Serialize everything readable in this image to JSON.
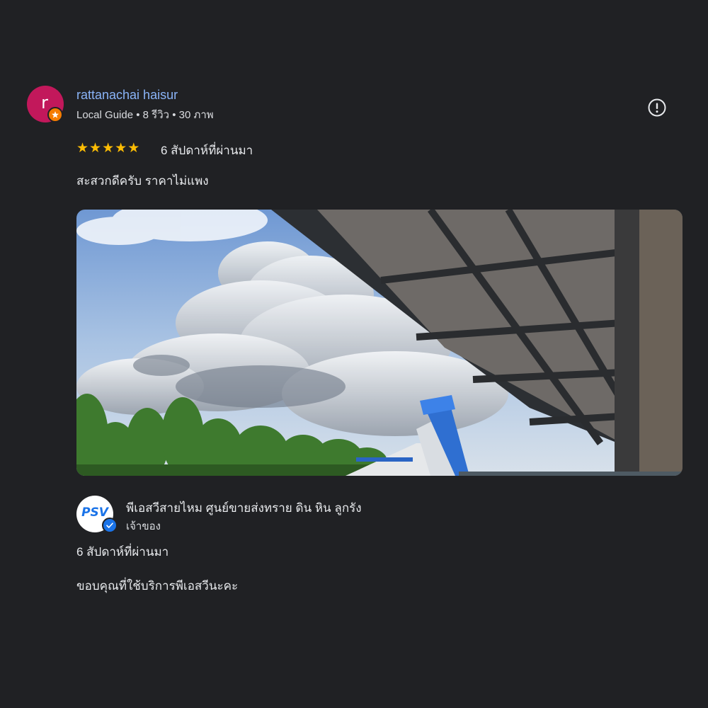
{
  "reviewer": {
    "avatar_letter": "r",
    "name": "rattanachai haisur",
    "meta": "Local Guide • 8 รีวิว • 30 ภาพ",
    "badge_icon": "local-guide-star-icon",
    "avatar_color": "#c2185b",
    "badge_color": "#f57c00"
  },
  "review": {
    "rating": 5,
    "max_rating": 5,
    "stars": [
      "★",
      "★",
      "★",
      "★",
      "★"
    ],
    "date": "6 สัปดาห์ที่ผ่านมา",
    "text": "สะสวกดีครับ ราคาไม่แพง",
    "photo": "sky-and-roof-with-blue-truck-photo"
  },
  "more_button": {
    "icon": "report-exclamation-icon"
  },
  "owner_response": {
    "avatar_text": "PSV",
    "name": "พีเอสวีสายไหม ศูนย์ขายส่งทราย ดิน หิน ลูกรัง",
    "label": "เจ้าของ",
    "date": "6 สัปดาห์ที่ผ่านมา",
    "text": "ขอบคุณที่ใช้บริการพีเอสวีนะคะ",
    "verified_icon": "verified-check-icon"
  },
  "colors": {
    "background": "#202124",
    "link": "#8ab4f8",
    "star": "#fbbc04",
    "verified": "#1a73e8"
  }
}
